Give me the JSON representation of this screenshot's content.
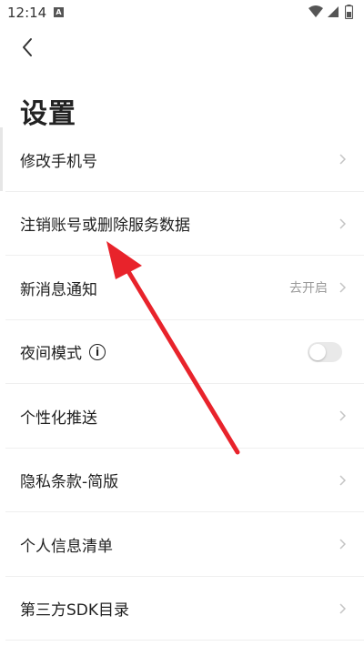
{
  "status_bar": {
    "time": "12:14",
    "notification_letter": "A"
  },
  "page": {
    "title": "设置"
  },
  "settings": {
    "items": [
      {
        "label": "修改手机号"
      },
      {
        "label": "注销账号或删除服务数据"
      },
      {
        "label": "新消息通知",
        "value": "去开启"
      },
      {
        "label": "夜间模式",
        "toggle_on": false
      },
      {
        "label": "个性化推送"
      },
      {
        "label": "隐私条款-简版"
      },
      {
        "label": "个人信息清单"
      },
      {
        "label": "第三方SDK目录"
      }
    ]
  },
  "colors": {
    "annotation_arrow": "#e8232b",
    "chevron": "#c4c4c4",
    "secondary_text": "#9a9a9a"
  },
  "icons": {
    "back": "chevron-left-icon",
    "row_arrow": "chevron-right-icon",
    "info": "info-circle-icon"
  }
}
